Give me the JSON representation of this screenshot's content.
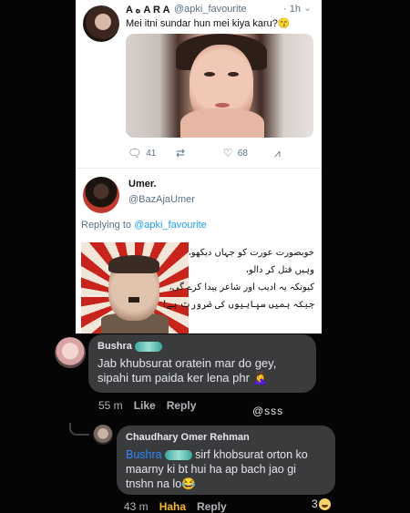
{
  "tweet": {
    "author_name": "A ه A R A",
    "handle": "@apki_favourite",
    "time": "· 1h",
    "text": "Mei itni sundar hun mei kiya karu?😙",
    "reply_count": "41",
    "like_count": "68"
  },
  "reply": {
    "author_name": "Umer.",
    "handle": "@BazAjaUmer",
    "replying_prefix": "Replying to",
    "replying_to": "@apki_favourite",
    "meme_text": [
      "خوبصورت عورت کو جہاں دیکھو،",
      "وہیں قتل کر دالو،",
      "کیونکہ یہ ادیب اور شاعر پیدا کرے گی،",
      "جبکہ ہمیں سپاہیوں کی ضرورت ہے!"
    ]
  },
  "comments": [
    {
      "author": "Bushra",
      "text": "Jab khubsurat oratein mar do gey, sipahi tum paida ker lena phr 🤦‍♀️",
      "time": "55 m",
      "like_label": "Like",
      "reply_label": "Reply",
      "tag": "@sss"
    },
    {
      "author": "Chaudhary Omer Rehman",
      "mention": "Bushra",
      "text": " sirf khobsurat orton ko maarny ki bt hui ha ap bach jao gi tnshn na lo😂",
      "time": "43 m",
      "reaction_label": "Haha",
      "reply_label": "Reply",
      "reaction_count": "3"
    }
  ]
}
